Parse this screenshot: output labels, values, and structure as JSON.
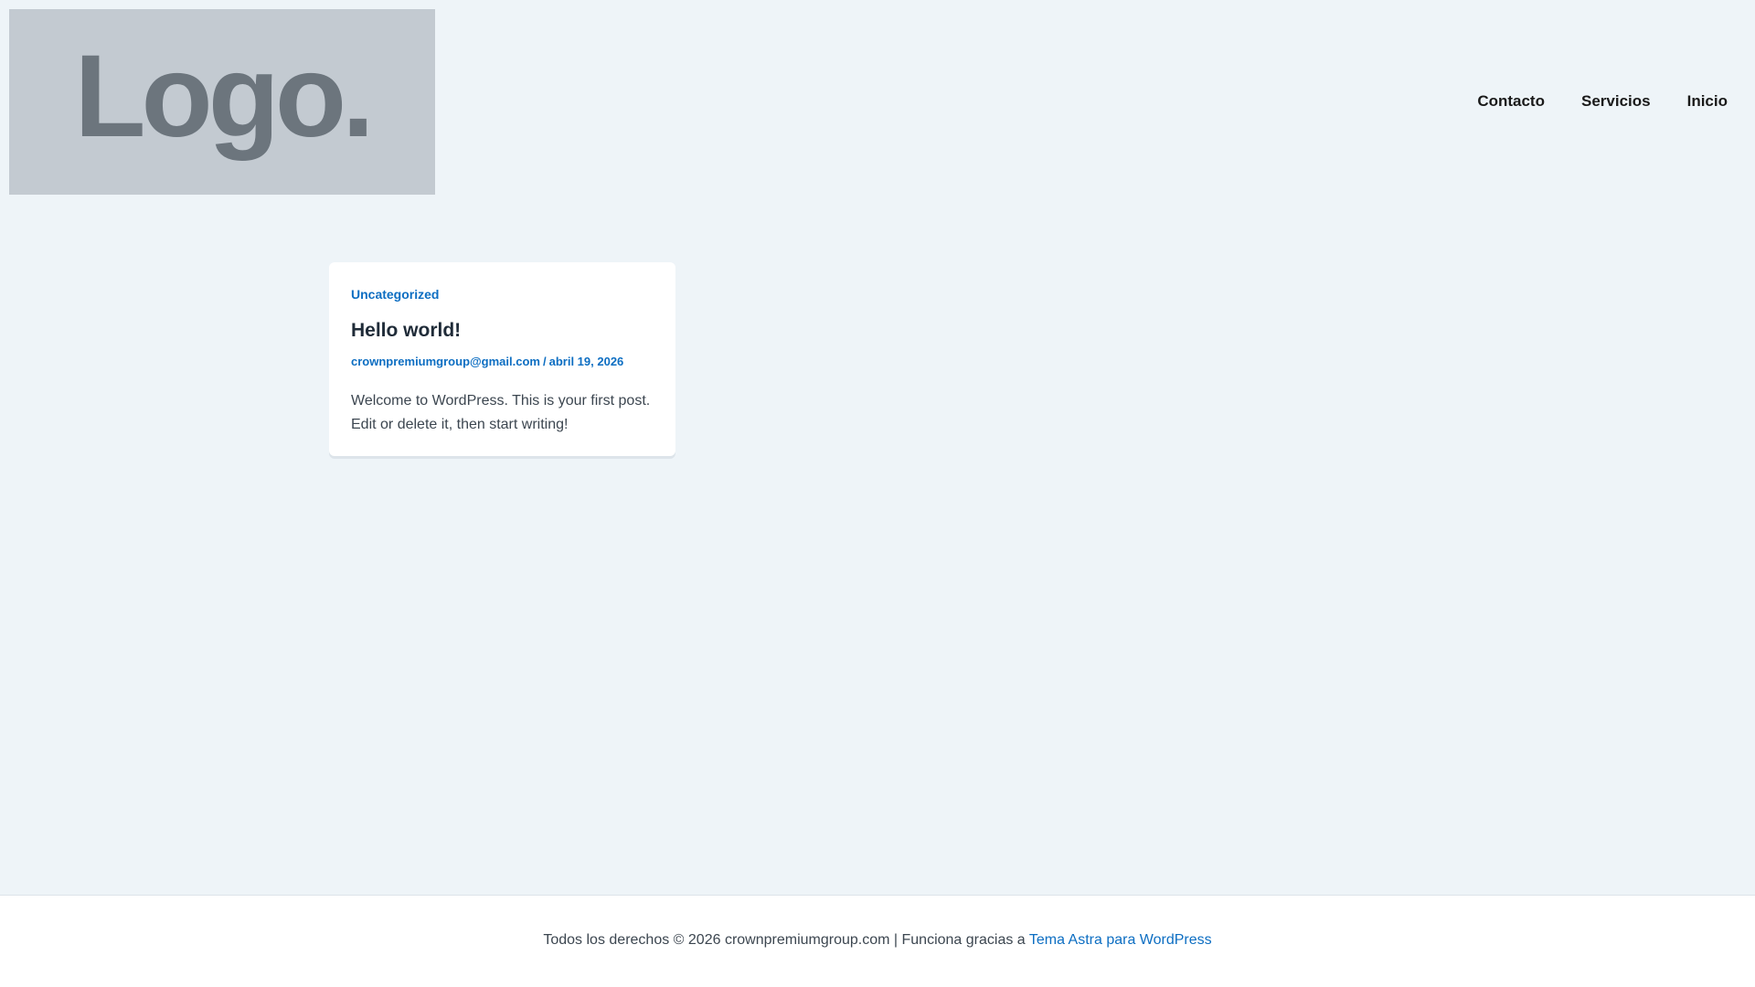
{
  "header": {
    "logo_text": "Logo.",
    "nav": [
      {
        "label": "Contacto"
      },
      {
        "label": "Servicios"
      },
      {
        "label": "Inicio"
      }
    ]
  },
  "post": {
    "category": "Uncategorized",
    "title": "Hello world!",
    "author": "crownpremiumgroup@gmail.com",
    "separator": "/",
    "date": "abril 19, 2026",
    "excerpt": "Welcome to WordPress. This is your first post. Edit or delete it, then start writing!"
  },
  "footer": {
    "text": "Todos los derechos © 2026 crownpremiumgroup.com | Funciona gracias a ",
    "link_label": "Tema Astra para WordPress"
  },
  "colors": {
    "page_background": "#eef4f8",
    "accent": "#0d6ec2",
    "logo_box": "#c3cad1",
    "logo_text": "#6c757d"
  }
}
